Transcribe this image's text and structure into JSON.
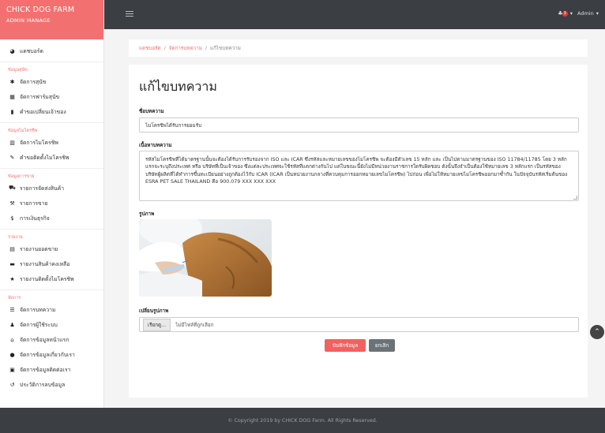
{
  "brand": {
    "title": "CHICK DOG FARM",
    "subtitle": "ADMIN MANAGE"
  },
  "topbar": {
    "notif_count": "3",
    "user": "Admin"
  },
  "sidebar": {
    "dashboard": "แดชบอร์ด",
    "sections": [
      {
        "title": "ข้อมูลสุนัข",
        "items": [
          "จัดการสุนัข",
          "จัดการฟาร์มสุนัข",
          "คำขอเปลี่ยนเจ้าของ"
        ]
      },
      {
        "title": "ข้อมูลไมโครชิพ",
        "items": [
          "จัดการไมโครชิพ",
          "คำขอติดตั้งไมโครชิพ"
        ]
      },
      {
        "title": "ข้อมูลการขาย",
        "items": [
          "รายการจัดส่งสินค้า",
          "รายการขาย",
          "การเงินธุรกิจ"
        ]
      },
      {
        "title": "รายงาน",
        "items": [
          "รายงานยอดขาย",
          "รายงานสินค้าคงเหลือ",
          "รายงานติดตั้งไมโครชิพ"
        ]
      },
      {
        "title": "จัดการ",
        "items": [
          "จัดการบทความ",
          "จัดการผู้ใช้ระบบ",
          "จัดการข้อมูลหน้าแรก",
          "จัดการข้อมูลเกี่ยวกับเรา",
          "จัดการข้อมูลติดต่อเรา",
          "ประวัติการลบข้อมูล"
        ]
      }
    ]
  },
  "breadcrumb": {
    "home": "แดชบอร์ด",
    "section": "จัดการบทความ",
    "current": "แก้ไขบทความ"
  },
  "form": {
    "heading": "แก้ไขบทความ",
    "title_label": "ชื่อบทความ",
    "title_value": "ไมโครชิพได้รับการยอมรับ",
    "desc_label": "เนื้อหาบทความ",
    "desc_value": "รหัสไมโครชิพที่ได้มาตรฐานนั้นจะต้องได้รับการรับรองจาก ISO และ ICAR ซึ่งรหัสและหมายเลขของไมโครชิพ จะต้องมีตัวเลข 15 หลัก และ เป็นไปตามมาตรฐานของ ISO 11784/11785 โดย 3 หลักแรกจะระบุถึงประเทศ หรือ บริษัทที่เป็นเจ้าของ ซึ่งแต่ละประเทศจะใช้รหัสที่แตกต่างกันไป แต่ในขณะนี้ยังไม่มีหน่วยงานราชการใดรับผิดชอบ ดังนั้นจึงจำเป็นต้องใช้หมายเลข 3 หลักแรก เป็นรหัสของบริษัทผู้ผลิตที่ได้ทำการขึ้นทะเบียนอย่างถูกต้องไว้กับ ICAR (ICAR เป็นหน่วยงานกลางที่ควบคุมการออกหมายเลขไมโครชิพ) ไปก่อน เพื่อไม่ให้หมายเลขไมโครชิพออกมาซ้ำกัน ในปัจจุบันรหัสเริ่มต้นของ ESRA PET SALE THAILAND คือ 900.079 XXX XXX XXX",
    "image_label": "รูปภาพ",
    "change_image_label": "เปลี่ยนรูปภาพ",
    "browse_label": "เรียกดู...",
    "no_file": "ไม่มีไฟล์ที่ถูกเลือก",
    "save_label": "บันทึกข้อมูล",
    "cancel_label": "ยกเลิก"
  },
  "footer": {
    "text": "© Copyright 2019 by CHICK DOG Farm. All Rights Reserved."
  },
  "colors": {
    "accent": "#f37070",
    "topbar": "#3b3f44",
    "cancel": "#6b7378"
  }
}
